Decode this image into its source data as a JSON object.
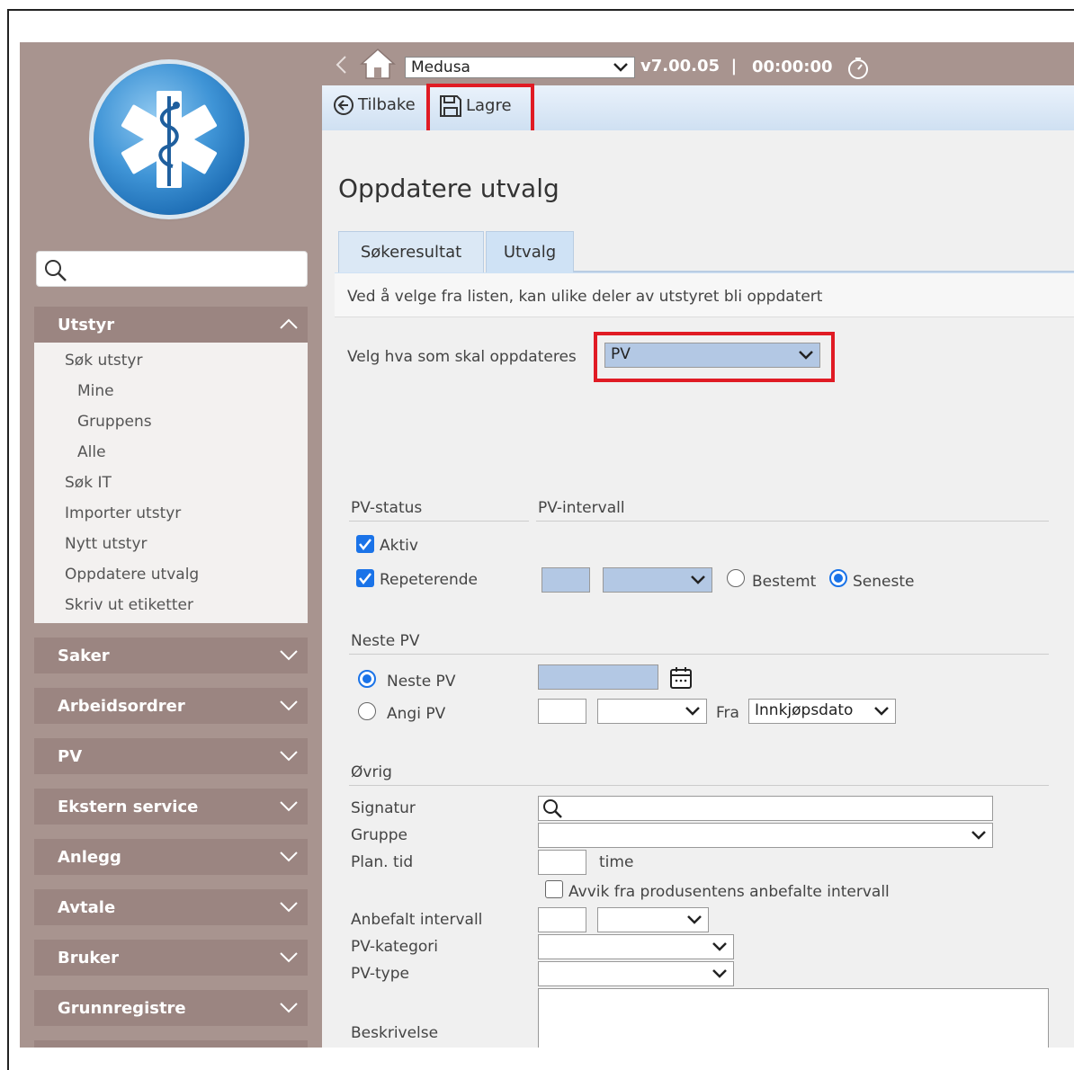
{
  "topbar": {
    "app_name": "Medusa",
    "version": "v7.00.05",
    "separator": "|",
    "timer": "00:00:00"
  },
  "toolbar": {
    "back_label": "Tilbake",
    "save_label": "Lagre"
  },
  "sidebar": {
    "search_placeholder": "",
    "sections": [
      {
        "label": "Utstyr",
        "expanded": true
      },
      {
        "label": "Saker"
      },
      {
        "label": "Arbeidsordrer"
      },
      {
        "label": "PV"
      },
      {
        "label": "Ekstern service"
      },
      {
        "label": "Anlegg"
      },
      {
        "label": "Avtale"
      },
      {
        "label": "Bruker"
      },
      {
        "label": "Grunnregistre"
      }
    ],
    "utstyr_items": [
      "Søk utstyr",
      "Mine",
      "Gruppens",
      "Alle",
      "Søk IT",
      "Importer utstyr",
      "Nytt utstyr",
      "Oppdatere utvalg",
      "Skriv ut etiketter"
    ]
  },
  "page": {
    "title": "Oppdatere utvalg",
    "tabs": [
      "Søkeresultat",
      "Utvalg"
    ],
    "active_tab": "Utvalg",
    "info": "Ved å velge fra listen, kan ulike deler av utstyret bli oppdatert",
    "select_label": "Velg hva som skal oppdateres",
    "select_value": "PV"
  },
  "pv_status": {
    "heading": "PV-status",
    "aktiv_label": "Aktiv",
    "aktiv_checked": true,
    "repeterende_label": "Repeterende",
    "repeterende_checked": true
  },
  "pv_intervall": {
    "heading": "PV-intervall",
    "bestemt_label": "Bestemt",
    "seneste_label": "Seneste",
    "selected": "Seneste"
  },
  "neste_pv": {
    "heading": "Neste PV",
    "neste_label": "Neste PV",
    "angi_label": "Angi PV",
    "selected": "Neste PV",
    "fra_label": "Fra",
    "fra_value": "Innkjøpsdato"
  },
  "ovrig": {
    "heading": "Øvrig",
    "signatur_label": "Signatur",
    "gruppe_label": "Gruppe",
    "plan_tid_label": "Plan. tid",
    "time_unit": "time",
    "avvik_label": "Avvik fra produsentens anbefalte intervall",
    "avvik_checked": false,
    "anbefalt_label": "Anbefalt intervall",
    "kategori_label": "PV-kategori",
    "type_label": "PV-type",
    "beskrivelse_label": "Beskrivelse"
  },
  "colors": {
    "sidebar_bg": "#a8948f",
    "highlight": "#e01b24",
    "input_blue": "#b3c8e4",
    "check_blue": "#1a73e8"
  }
}
